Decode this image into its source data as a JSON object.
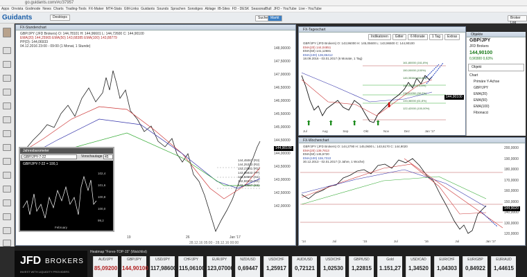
{
  "browser": {
    "url": "go.guidants.com/#c/37957",
    "bookmarks": [
      "Apps",
      "Onvista",
      "Godmode",
      "News",
      "Charts",
      "Trading-Tools",
      "FX-Maker",
      "MT4-Stats",
      "GM-Links",
      "Guidants",
      "Sounds",
      "Sprachen",
      "Sonstiges",
      "Ablage",
      "IB-Sites",
      "FD - DESK",
      "SeasonalBull",
      "JFD - YouTube",
      "Live - YouTube"
    ]
  },
  "header": {
    "logo": "Guidants",
    "desktop_label": "Desktops",
    "search_label": "Suche",
    "market_label": "Markt",
    "broker_label": "Broker Log"
  },
  "hourly": {
    "title": "FX-Stundenchart",
    "legend": [
      "GBP/JPY (JFD Brokers) O: 144,78101 H: 144,96601 L: 144,72600 C: 144,90100",
      "EMA(20) 144,25965   EMA(50) 143,68385   EMA(100) 143,88779",
      "PP(D): 144,06933",
      "04.12.2016 23:00 - 09:00 (1 Monat, 1 Stunde)"
    ],
    "price_label": "144,90100",
    "price_ticks": [
      "148,00000",
      "147,50000",
      "147,00000",
      "146,50000",
      "146,00000",
      "145,50000",
      "145,00000",
      "144,50000",
      "144,00000",
      "143,50000",
      "143,00000",
      "142,50000",
      "142,00000"
    ],
    "pivots": [
      "144,45067 (R3)",
      "144,25333 (R2)",
      "143,17561 (R1)",
      "143,06933 (PP)",
      "142,84567 (S1)",
      "142,59333 (S2)",
      "142,40567 (S3)"
    ],
    "x_ticks": [
      "19",
      "26",
      "Jan '17"
    ],
    "footer": "28.12.16 05:00 - 28.12.16 00:00"
  },
  "daily": {
    "title": "FX-Tageschart",
    "legend": [
      "GBP/JPY (JFD Brokers) O: 143,96000 H: 145,05600 L: 143,96500 C: 144,90100",
      "EMA(20) 144,04851",
      "EMA(50) 141,12681",
      "EMA(100) 136,86412",
      "18.09.2016 - 03.01.2017 (6 Monate, 1 Tag)"
    ],
    "fib": [
      "161,80000 (161,8%)",
      "150,00000 (100%)",
      "145,35384 (68,8%)",
      "142,31115 (23,6%)",
      "138,61050 (38,2%)",
      "133,36000 (61,8%)",
      "122,42000 (100,00%)"
    ],
    "price_ticks": [
      "160,00000",
      "150,00000",
      "140,00000",
      "130,00000"
    ],
    "x_ticks": [
      "Jul",
      "Aug",
      "Sep",
      "Okt",
      "Nov",
      "Dez",
      "Jan '17"
    ],
    "price_label": "144,90100",
    "toolbar": [
      "Indikatoren",
      "Gitter",
      "6 Monate",
      "1 Tag",
      "Extras"
    ]
  },
  "weekly": {
    "title": "FX-Wochenchart",
    "legend": [
      "GBP/JPY (JFD Brokers) O: 144,2790 H: 145,0600 L: 143,6170 C: 144,9020",
      "EMA(20) 139,7813",
      "EMA(50) 145,6720",
      "EMA(100) 155,7310",
      "30.12.2013 - 02.01.2017 (3 Jahre, 1 Woche)"
    ],
    "price_ticks": [
      "200,0000",
      "190,0000",
      "180,0000",
      "170,0000",
      "160,0000",
      "150,0000",
      "140,0000",
      "130,0000",
      "120,0000"
    ],
    "x_ticks": [
      "'14",
      "Jul",
      "'15",
      "Jul",
      "'16",
      "Jul",
      "Jan '17"
    ],
    "price_label": "144,9020"
  },
  "objects": {
    "title": "Objekte",
    "symbol": "GBP/JPY",
    "sub": "JFD Brokers",
    "price": "144,90100",
    "change": "0,90300  0,63%",
    "search": "Objekt",
    "items": [
      "Chart",
      "Primäre Y-Achse",
      "GBP/JPY",
      "EMA(20)",
      "EMA(50)",
      "EMA(100)",
      "Fibonacci"
    ]
  },
  "popup": {
    "title": "Jahresbarometer",
    "symbol": "GBP/JPY-7-22",
    "mode": "Vorschautage",
    "days": "45",
    "subtitle": "GBP/JPY-7-22 = 100,1",
    "y_ticks": [
      "102,4",
      "101,6",
      "100,8",
      "100,0",
      "99,2"
    ],
    "x_label": "February"
  },
  "ticker": {
    "title": "Heatmap \"Forex-TOP-15\" (Watchlist)",
    "brand": "JFD",
    "brand2": "BROKERS",
    "tagline": "INVEST WITH LIQUIDITY PROVIDERS",
    "items": [
      {
        "s": "AUD/JPY",
        "v": "85,09200",
        "c": "#b22222"
      },
      {
        "s": "GBP/JPY",
        "v": "144,90100",
        "c": "#b22222"
      },
      {
        "s": "USD/JPY",
        "v": "117,98600",
        "c": "#222"
      },
      {
        "s": "CHF/JPY",
        "v": "115,06100",
        "c": "#222"
      },
      {
        "s": "EUR/JPY",
        "v": "123,07000",
        "c": "#222"
      },
      {
        "s": "NZD/USD",
        "v": "0,69447",
        "c": "#222"
      },
      {
        "s": "USD/CHF",
        "v": "1,25917",
        "c": "#222"
      },
      {
        "s": "AUD/USD",
        "v": "0,72121",
        "c": "#222"
      },
      {
        "s": "USD/CHF",
        "v": "1,02530",
        "c": "#222"
      },
      {
        "s": "GBP/USD",
        "v": "1,22815",
        "c": "#222"
      },
      {
        "s": "Gold",
        "v": "1.151,27",
        "c": "#222"
      },
      {
        "s": "USD/CAD",
        "v": "1,34520",
        "c": "#222"
      },
      {
        "s": "EUR/CHF",
        "v": "1,04303",
        "c": "#222"
      },
      {
        "s": "EUR/GBP",
        "v": "0,84922",
        "c": "#222"
      },
      {
        "s": "EUR/AUD",
        "v": "1,44615",
        "c": "#222"
      }
    ]
  }
}
